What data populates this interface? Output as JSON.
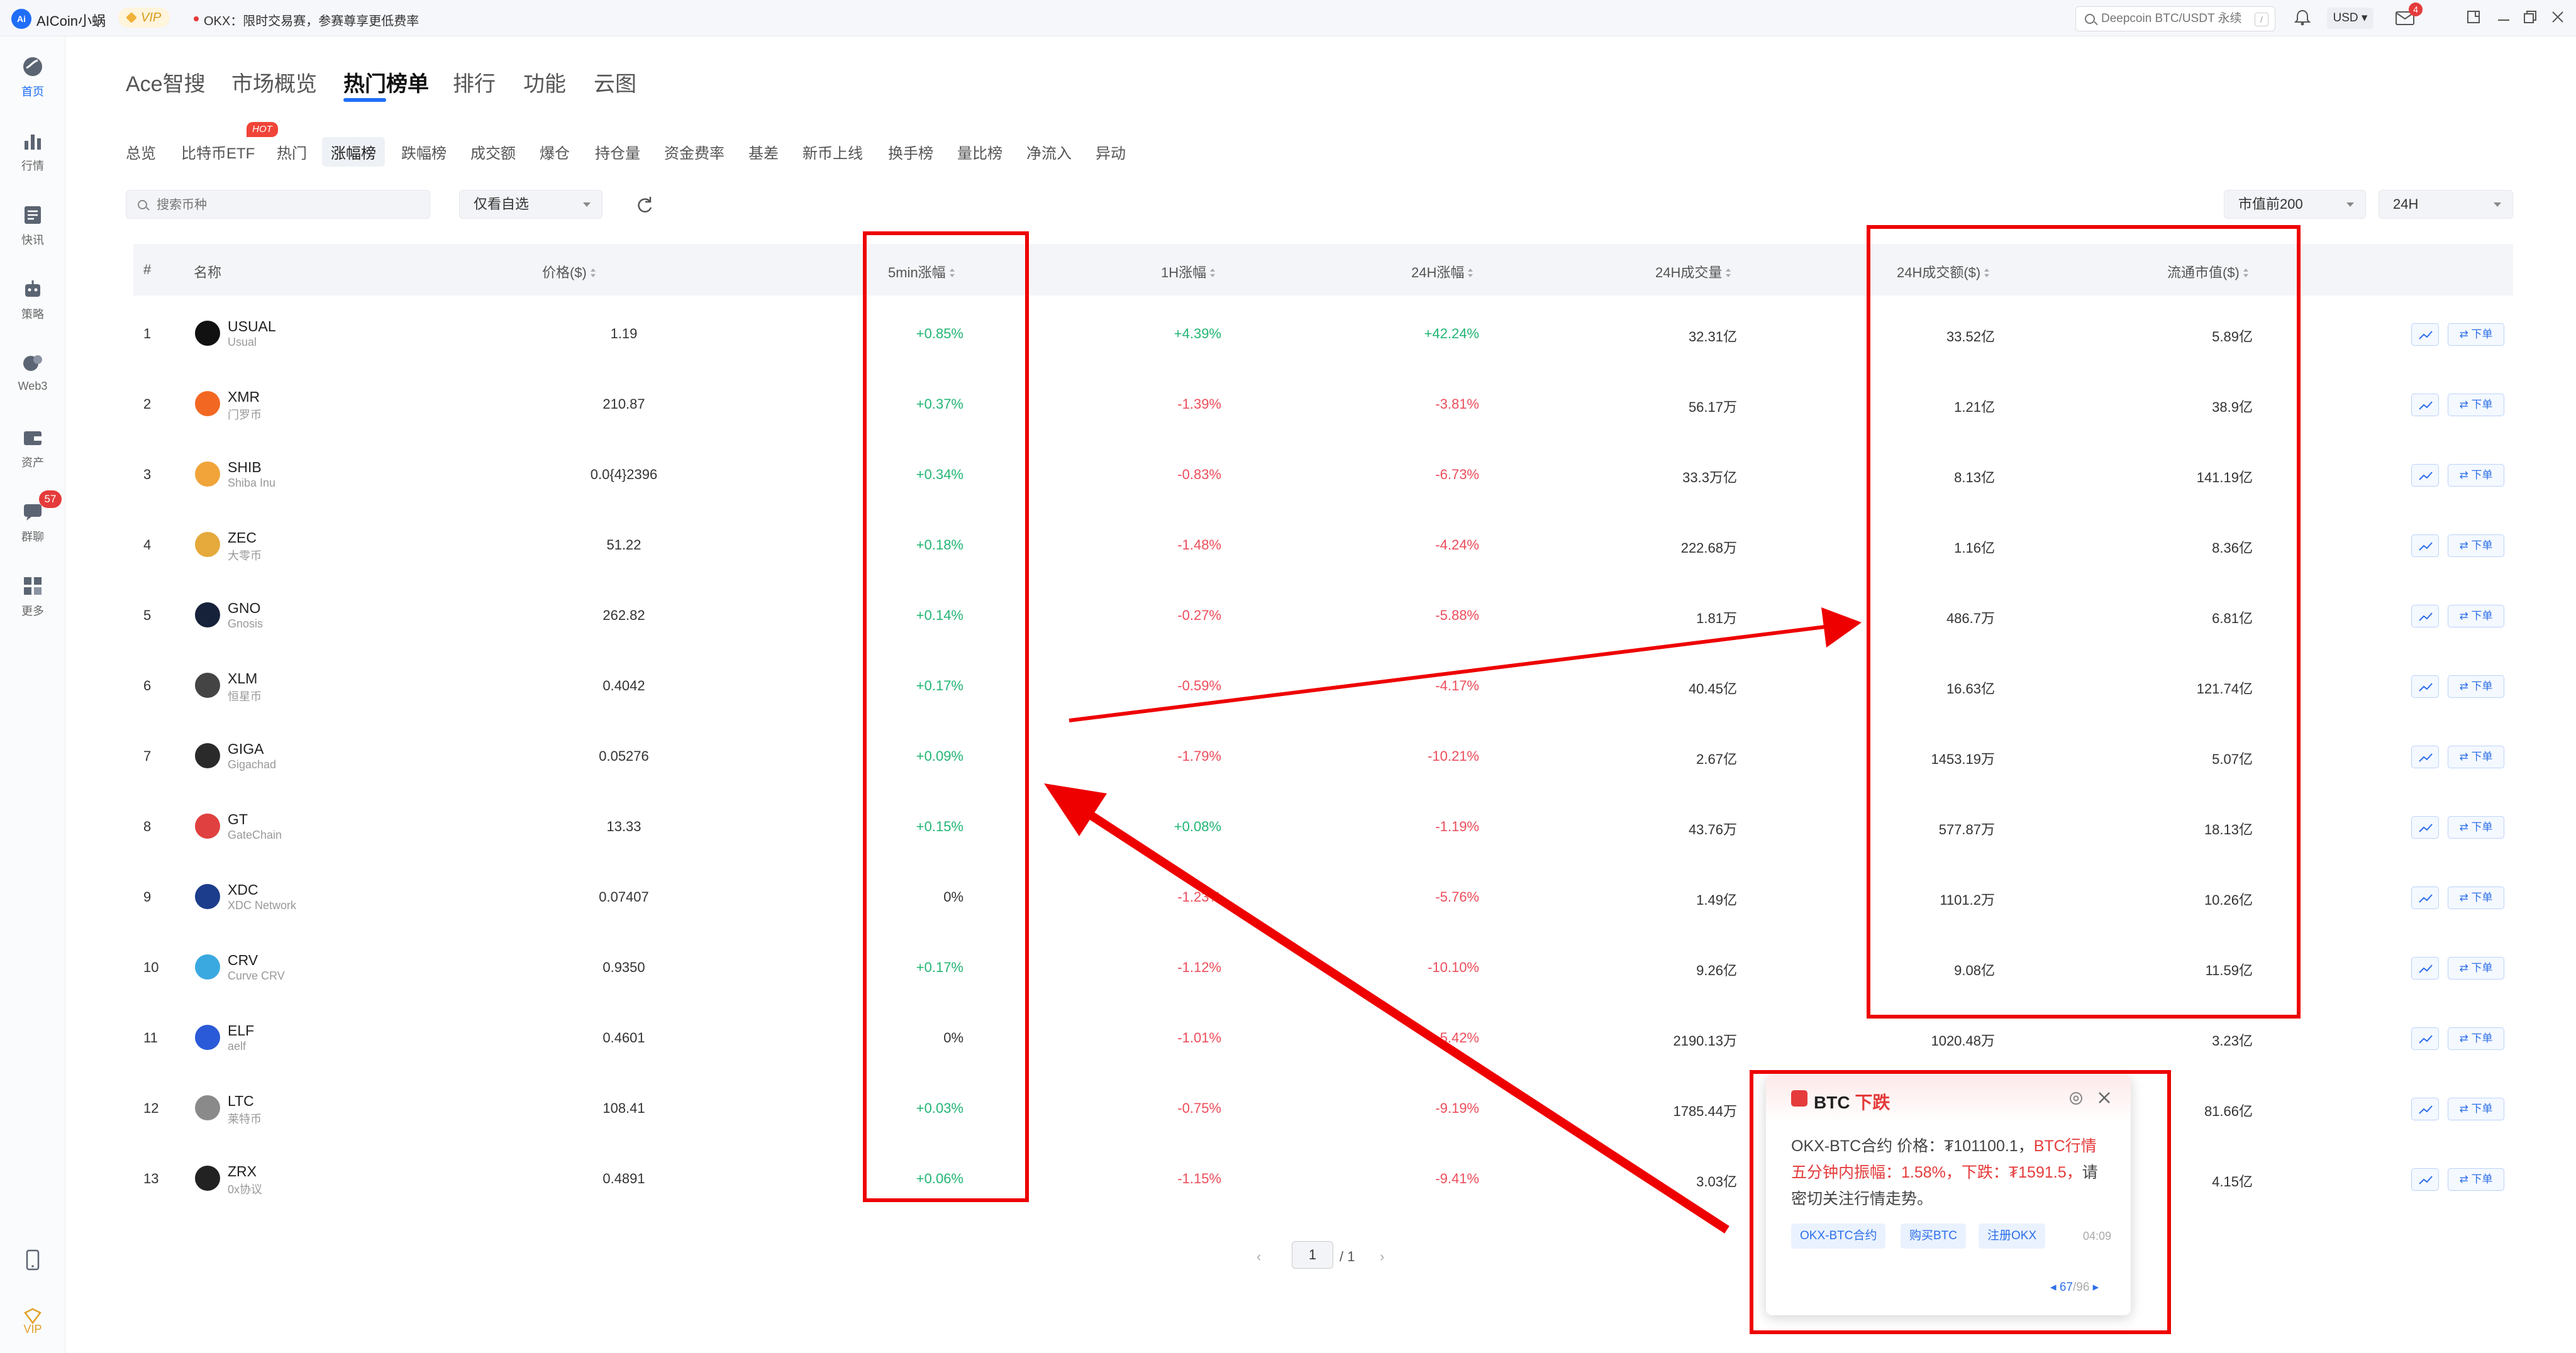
{
  "titlebar": {
    "app_title": "AICoin小蜗",
    "logo_text": "Ai",
    "vip_label": "VIP",
    "notice": "OKX：限时交易赛，参赛尊享更低费率",
    "search_placeholder": "Deepcoin BTC/USDT 永续",
    "search_shortcut": "/",
    "currency": "USD ▾",
    "mail_count": "4"
  },
  "siderail": {
    "items": [
      {
        "label": "首页",
        "icon": "home-icon"
      },
      {
        "label": "行情",
        "icon": "market-icon"
      },
      {
        "label": "快讯",
        "icon": "news-icon"
      },
      {
        "label": "策略",
        "icon": "robot-icon"
      },
      {
        "label": "Web3",
        "icon": "web3-icon"
      },
      {
        "label": "资产",
        "icon": "wallet-icon"
      },
      {
        "label": "群聊",
        "icon": "chat-icon"
      },
      {
        "label": "更多",
        "icon": "grid-icon"
      }
    ],
    "chat_badge": "57",
    "bottom": [
      {
        "label": "",
        "icon": "phone-icon"
      },
      {
        "label": "VIP",
        "icon": "vip-icon"
      }
    ]
  },
  "main_tabs": [
    "Ace智搜",
    "市场概览",
    "热门榜单",
    "排行",
    "功能",
    "云图"
  ],
  "main_tab_active": 2,
  "sub_tabs": [
    "总览",
    "比特币ETF",
    "热门",
    "涨幅榜",
    "跌幅榜",
    "成交额",
    "爆仓",
    "持仓量",
    "资金费率",
    "基差",
    "新币上线",
    "换手榜",
    "量比榜",
    "净流入",
    "异动"
  ],
  "sub_tab_hot_badge": "HOT",
  "filters": {
    "search_placeholder": "搜索币种",
    "watch_only": "仅看自选",
    "rank_range": "市值前200",
    "period": "24H"
  },
  "table": {
    "headers": {
      "rank": "#",
      "name": "名称",
      "price": "价格($)",
      "chg_5m": "5min涨幅",
      "chg_1h": "1H涨幅",
      "chg_24h": "24H涨幅",
      "vol_24h": "24H成交量",
      "amount_24h": "24H成交额($)",
      "mcap": "流通市值($)"
    },
    "order_label": "⇄ 下单",
    "rows": [
      {
        "rank": "1",
        "sym": "USUAL",
        "name": "Usual",
        "price": "1.19",
        "chg_5m": "+0.85%",
        "chg_1h": "+4.39%",
        "chg_24h": "+42.24%",
        "vol": "32.31亿",
        "amount": "33.52亿",
        "mcap": "5.89亿",
        "color": "#111111"
      },
      {
        "rank": "2",
        "sym": "XMR",
        "name": "门罗币",
        "price": "210.87",
        "chg_5m": "+0.37%",
        "chg_1h": "-1.39%",
        "chg_24h": "-3.81%",
        "vol": "56.17万",
        "amount": "1.21亿",
        "mcap": "38.9亿",
        "color": "#f26822"
      },
      {
        "rank": "3",
        "sym": "SHIB",
        "name": "Shiba Inu",
        "price": "0.0{4}2396",
        "chg_5m": "+0.34%",
        "chg_1h": "-0.83%",
        "chg_24h": "-6.73%",
        "vol": "33.3万亿",
        "amount": "8.13亿",
        "mcap": "141.19亿",
        "color": "#f0a43a"
      },
      {
        "rank": "4",
        "sym": "ZEC",
        "name": "大零币",
        "price": "51.22",
        "chg_5m": "+0.18%",
        "chg_1h": "-1.48%",
        "chg_24h": "-4.24%",
        "vol": "222.68万",
        "amount": "1.16亿",
        "mcap": "8.36亿",
        "color": "#e5a93c"
      },
      {
        "rank": "5",
        "sym": "GNO",
        "name": "Gnosis",
        "price": "262.82",
        "chg_5m": "+0.14%",
        "chg_1h": "-0.27%",
        "chg_24h": "-5.88%",
        "vol": "1.81万",
        "amount": "486.7万",
        "mcap": "6.81亿",
        "color": "#16213a"
      },
      {
        "rank": "6",
        "sym": "XLM",
        "name": "恒星币",
        "price": "0.4042",
        "chg_5m": "+0.17%",
        "chg_1h": "-0.59%",
        "chg_24h": "-4.17%",
        "vol": "40.45亿",
        "amount": "16.63亿",
        "mcap": "121.74亿",
        "color": "#444444"
      },
      {
        "rank": "7",
        "sym": "GIGA",
        "name": "Gigachad",
        "price": "0.05276",
        "chg_5m": "+0.09%",
        "chg_1h": "-1.79%",
        "chg_24h": "-10.21%",
        "vol": "2.67亿",
        "amount": "1453.19万",
        "mcap": "5.07亿",
        "color": "#2a2a2a"
      },
      {
        "rank": "8",
        "sym": "GT",
        "name": "GateChain",
        "price": "13.33",
        "chg_5m": "+0.15%",
        "chg_1h": "+0.08%",
        "chg_24h": "-1.19%",
        "vol": "43.76万",
        "amount": "577.87万",
        "mcap": "18.13亿",
        "color": "#e04040"
      },
      {
        "rank": "9",
        "sym": "XDC",
        "name": "XDC Network",
        "price": "0.07407",
        "chg_5m": "0%",
        "chg_1h": "-1.23%",
        "chg_24h": "-5.76%",
        "vol": "1.49亿",
        "amount": "1101.2万",
        "mcap": "10.26亿",
        "color": "#1c3c8c"
      },
      {
        "rank": "10",
        "sym": "CRV",
        "name": "Curve CRV",
        "price": "0.9350",
        "chg_5m": "+0.17%",
        "chg_1h": "-1.12%",
        "chg_24h": "-10.10%",
        "vol": "9.26亿",
        "amount": "9.08亿",
        "mcap": "11.59亿",
        "color": "#3aa9e0"
      },
      {
        "rank": "11",
        "sym": "ELF",
        "name": "aelf",
        "price": "0.4601",
        "chg_5m": "0%",
        "chg_1h": "-1.01%",
        "chg_24h": "-5.42%",
        "vol": "2190.13万",
        "amount": "1020.48万",
        "mcap": "3.23亿",
        "color": "#2b5ad8"
      },
      {
        "rank": "12",
        "sym": "LTC",
        "name": "莱特币",
        "price": "108.41",
        "chg_5m": "+0.03%",
        "chg_1h": "-0.75%",
        "chg_24h": "-9.19%",
        "vol": "1785.44万",
        "amount": "",
        "mcap": "81.66亿",
        "color": "#8a8a8a"
      },
      {
        "rank": "13",
        "sym": "ZRX",
        "name": "0x协议",
        "price": "0.4891",
        "chg_5m": "+0.06%",
        "chg_1h": "-1.15%",
        "chg_24h": "-9.41%",
        "vol": "3.03亿",
        "amount": "",
        "mcap": "4.15亿",
        "color": "#222222"
      }
    ]
  },
  "pagination": {
    "prev": "‹",
    "current": "1",
    "total": "/ 1",
    "next": "›"
  },
  "alert": {
    "title_coin": "BTC",
    "title_dir": "下跌",
    "body_a": "OKX-BTC合约 价格：₮101100.1，",
    "body_hl1": "BTC行情五分钟内振幅：1.58%，下跌：₮1591.5，",
    "body_b": "请密切关注行情走势。",
    "chips": [
      "OKX-BTC合约",
      "购买BTC",
      "注册OKX"
    ],
    "time": "04:09",
    "pager_cur": "67",
    "pager_total": "/96"
  },
  "colors": {
    "accent": "#1f6ef7",
    "up": "#22b573",
    "down": "#ec4d5b",
    "annotation": "#ee0000"
  }
}
